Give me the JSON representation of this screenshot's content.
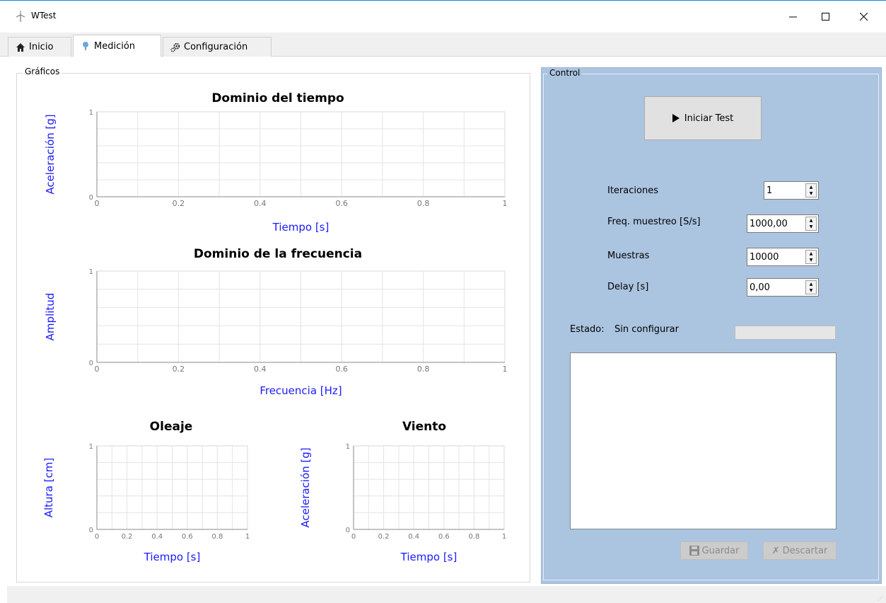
{
  "window": {
    "title": "WTest",
    "minimize_glyph": "─",
    "maximize_glyph": "☐",
    "close_glyph": "✕"
  },
  "tabs": [
    {
      "label": "Inicio",
      "icon": "home-icon"
    },
    {
      "label": "Medición",
      "icon": "probe-icon"
    },
    {
      "label": "Configuración",
      "icon": "gear-icon"
    }
  ],
  "graficos": {
    "title": "Gráficos"
  },
  "control": {
    "title": "Control",
    "start_button": "Iniciar Test",
    "fields": [
      {
        "label": "Iteraciones",
        "value": "1"
      },
      {
        "label": "Freq. muestreo [S/s]",
        "value": "1000,00"
      },
      {
        "label": "Muestras",
        "value": "10000"
      },
      {
        "label": "Delay [s]",
        "value": "0,00"
      }
    ],
    "status_label": "Estado:",
    "status_value": "Sin configurar",
    "progress": 0,
    "log_text": "",
    "save_button": "Guardar",
    "discard_button": "Descartar"
  },
  "colors": {
    "axis_label": "#1a1aff",
    "control_bg": "#abc4e0"
  },
  "chart_data": [
    {
      "type": "line",
      "title": "Dominio del tiempo",
      "xlabel": "Tiempo [s]",
      "ylabel": "Aceleración [g]",
      "xlim": [
        0,
        1
      ],
      "ylim": [
        0,
        1
      ],
      "xticks": [
        "0",
        "0.2",
        "0.4",
        "0.6",
        "0.8",
        "1"
      ],
      "yticks": [
        "0",
        "1"
      ],
      "grid": true,
      "series": []
    },
    {
      "type": "line",
      "title": "Dominio de la frecuencia",
      "xlabel": "Frecuencia [Hz]",
      "ylabel": "Amplitud",
      "xlim": [
        0,
        1
      ],
      "ylim": [
        0,
        1
      ],
      "xticks": [
        "0",
        "0.2",
        "0.4",
        "0.6",
        "0.8",
        "1"
      ],
      "yticks": [
        "0",
        "1"
      ],
      "grid": true,
      "series": []
    },
    {
      "type": "line",
      "title": "Oleaje",
      "xlabel": "Tiempo [s]",
      "ylabel": "Altura [cm]",
      "xlim": [
        0,
        1
      ],
      "ylim": [
        0,
        1
      ],
      "xticks": [
        "0",
        "0.2",
        "0.4",
        "0.6",
        "0.8",
        "1"
      ],
      "yticks": [
        "0",
        "1"
      ],
      "grid": true,
      "series": []
    },
    {
      "type": "line",
      "title": "Viento",
      "xlabel": "Tiempo [s]",
      "ylabel": "Aceleración [g]",
      "xlim": [
        0,
        1
      ],
      "ylim": [
        0,
        1
      ],
      "xticks": [
        "0",
        "0.2",
        "0.4",
        "0.6",
        "0.8",
        "1"
      ],
      "yticks": [
        "0",
        "1"
      ],
      "grid": true,
      "series": []
    }
  ]
}
